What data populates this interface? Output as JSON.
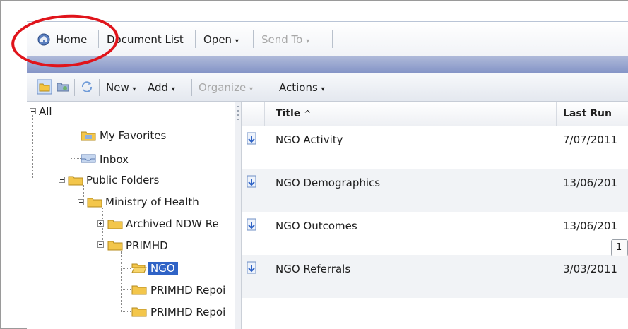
{
  "menubar": {
    "home": "Home",
    "document_list": "Document List",
    "open": "Open",
    "send_to": "Send To"
  },
  "toolbar": {
    "new": "New",
    "add": "Add",
    "organize": "Organize",
    "actions": "Actions"
  },
  "tree": {
    "all": "All",
    "my_favorites": "My Favorites",
    "inbox": "Inbox",
    "public_folders": "Public Folders",
    "ministry": "Ministry of Health",
    "archived": "Archived NDW Re",
    "primhd": "PRIMHD",
    "ngo": "NGO",
    "primhd_repo_1": "PRIMHD Repoi",
    "primhd_repo_2": "PRIMHD Repoi"
  },
  "list": {
    "header_title": "Title",
    "sort_indicator": "^",
    "header_last_run": "Last Run",
    "rows": [
      {
        "title": "NGO Activity",
        "last_run": "7/07/2011"
      },
      {
        "title": "NGO Demographics",
        "last_run": "13/06/201"
      },
      {
        "title": "NGO Outcomes",
        "last_run": "13/06/201"
      },
      {
        "title": "NGO Referrals",
        "last_run": "3/03/2011"
      }
    ],
    "tooltip": "1"
  },
  "colors": {
    "selection": "#2f63c6",
    "annotation": "#e0141b",
    "band": "#8393c6"
  }
}
